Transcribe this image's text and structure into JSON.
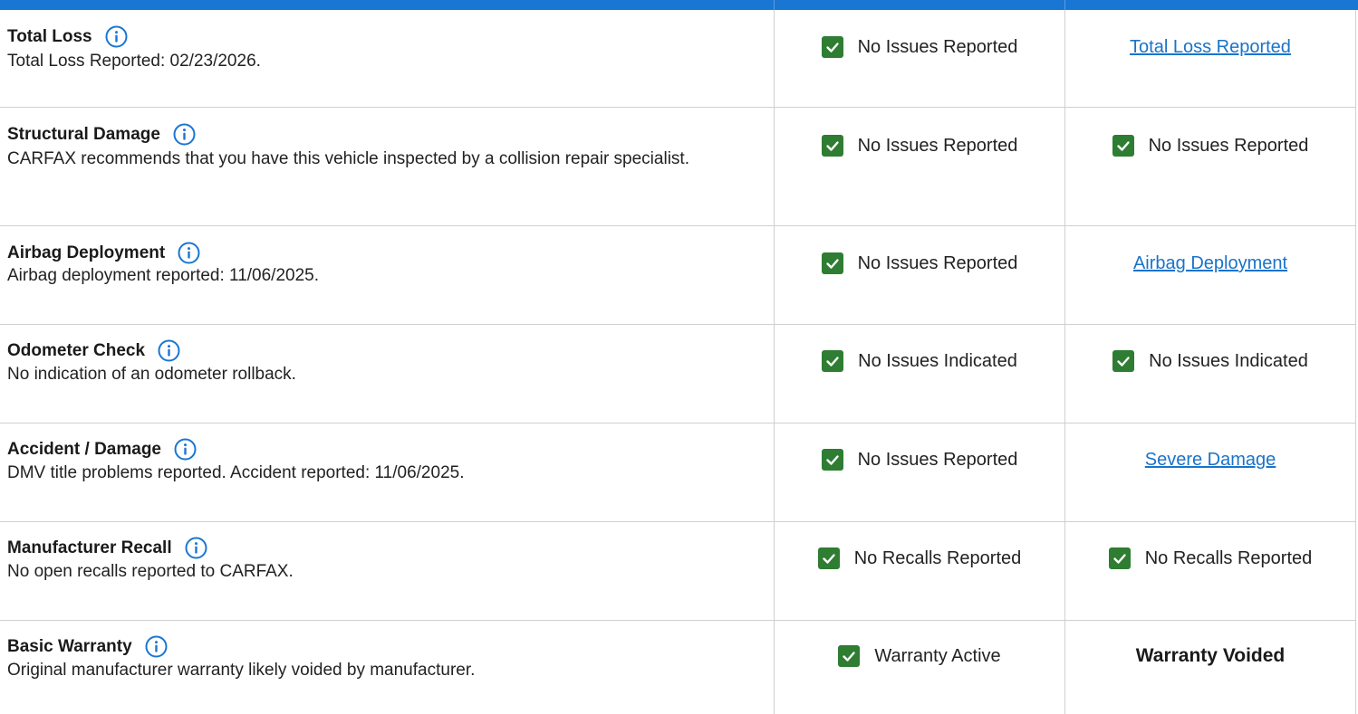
{
  "rows": [
    {
      "title": "Total Loss",
      "description": "Total Loss Reported: 02/23/2026.",
      "col1": {
        "type": "check",
        "text": "No Issues Reported"
      },
      "col2": {
        "type": "link",
        "text": "Total Loss Reported"
      }
    },
    {
      "title": "Structural Damage",
      "description": "CARFAX recommends that you have this vehicle inspected by a collision repair specialist.",
      "col1": {
        "type": "check",
        "text": "No Issues Reported"
      },
      "col2": {
        "type": "check",
        "text": "No Issues Reported"
      }
    },
    {
      "title": "Airbag Deployment",
      "description": "Airbag deployment reported: 11/06/2025.",
      "col1": {
        "type": "check",
        "text": "No Issues Reported"
      },
      "col2": {
        "type": "link",
        "text": "Airbag Deployment"
      }
    },
    {
      "title": "Odometer Check",
      "description": "No indication of an odometer rollback.",
      "col1": {
        "type": "check",
        "text": "No Issues Indicated"
      },
      "col2": {
        "type": "check",
        "text": "No Issues Indicated"
      }
    },
    {
      "title": "Accident / Damage",
      "description": "DMV title problems reported. Accident reported: 11/06/2025.",
      "col1": {
        "type": "check",
        "text": "No Issues Reported"
      },
      "col2": {
        "type": "link",
        "text": "Severe Damage"
      }
    },
    {
      "title": "Manufacturer Recall",
      "description": "No open recalls reported to CARFAX.",
      "col1": {
        "type": "check",
        "text": "No Recalls Reported"
      },
      "col2": {
        "type": "check",
        "text": "No Recalls Reported"
      }
    },
    {
      "title": "Basic Warranty",
      "description": "Original manufacturer warranty likely voided by manufacturer.",
      "col1": {
        "type": "check",
        "text": "Warranty Active"
      },
      "col2": {
        "type": "bold",
        "text": "Warranty Voided"
      }
    }
  ],
  "icons": {
    "info": "info-circle-icon",
    "check": "checkbox-checked-icon"
  },
  "colors": {
    "header_bar": "#1976d2",
    "check_green": "#2e7d32",
    "link_blue": "#1a73c9",
    "info_blue": "#1976d2",
    "divider": "#d0d0d0"
  }
}
